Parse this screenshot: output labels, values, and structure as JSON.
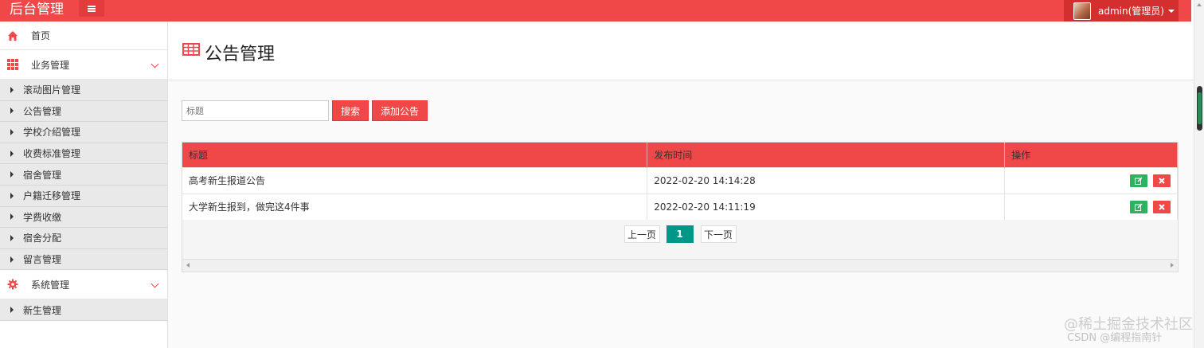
{
  "header": {
    "brand": "后台管理",
    "user": "admin(管理员)"
  },
  "sidebar": {
    "home": "首页",
    "groups": [
      {
        "label": "业务管理",
        "items": [
          "滚动图片管理",
          "公告管理",
          "学校介绍管理",
          "收费标准管理",
          "宿舍管理",
          "户籍迁移管理",
          "学费收缴",
          "宿舍分配",
          "留言管理"
        ]
      },
      {
        "label": "系统管理",
        "items": [
          "新生管理"
        ]
      }
    ]
  },
  "main": {
    "title": "公告管理",
    "search_placeholder": "标题",
    "search_button": "搜索",
    "add_button": "添加公告",
    "table": {
      "columns": [
        "标题",
        "发布时间",
        "操作"
      ],
      "rows": [
        {
          "title": "高考新生报道公告",
          "time": "2022-02-20 14:14:28"
        },
        {
          "title": "大学新生报到，做完这4件事",
          "time": "2022-02-20 14:11:19"
        }
      ]
    },
    "pagination": {
      "prev": "上一页",
      "current": "1",
      "next": "下一页"
    }
  },
  "watermark": "@稀土掘金技术社区",
  "watermark2": "CSDN @编程指南针",
  "colors": {
    "accent": "#f04848",
    "edit": "#2eb260",
    "page_current": "#009688"
  }
}
